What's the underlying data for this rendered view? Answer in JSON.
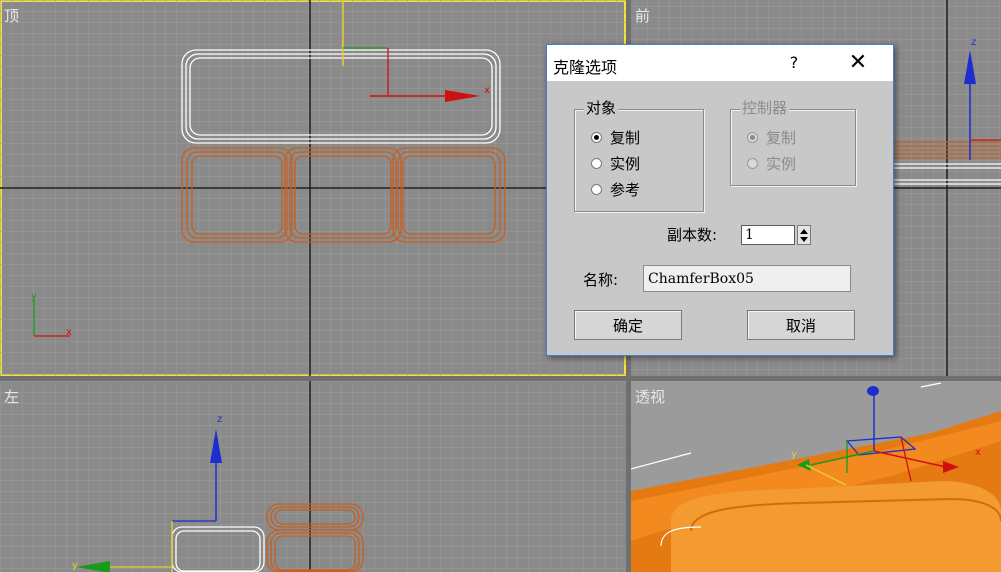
{
  "viewports": {
    "top": {
      "label": "顶"
    },
    "front": {
      "label": "前"
    },
    "left": {
      "label": "左"
    },
    "perspective": {
      "label": "透视"
    }
  },
  "axis_labels": {
    "x": "x",
    "y": "y",
    "z": "z"
  },
  "colors": {
    "viewport_bg": "#8a8a8a",
    "grid_line": "#9c9c9c",
    "axis_line": "#1e1e1e",
    "active_border": "#f2e23a",
    "selected_wire": "#ffffff",
    "object_wire": "#c8601c",
    "object_fill": "#f08a1e",
    "gizmo_x": "#d01010",
    "gizmo_y": "#1a9a1a",
    "gizmo_z": "#1c2ed0"
  },
  "dialog": {
    "title": "克隆选项",
    "help_label": "?",
    "close_glyph": "✕",
    "object_group": {
      "title": "对象",
      "options": [
        "复制",
        "实例",
        "参考"
      ],
      "selected": "复制"
    },
    "controller_group": {
      "title": "控制器",
      "options": [
        "复制",
        "实例"
      ],
      "selected": "复制",
      "enabled": false
    },
    "copies_label": "副本数:",
    "copies_value": "1",
    "name_label": "名称:",
    "name_value": "ChamferBox05",
    "ok_label": "确定",
    "cancel_label": "取消"
  }
}
